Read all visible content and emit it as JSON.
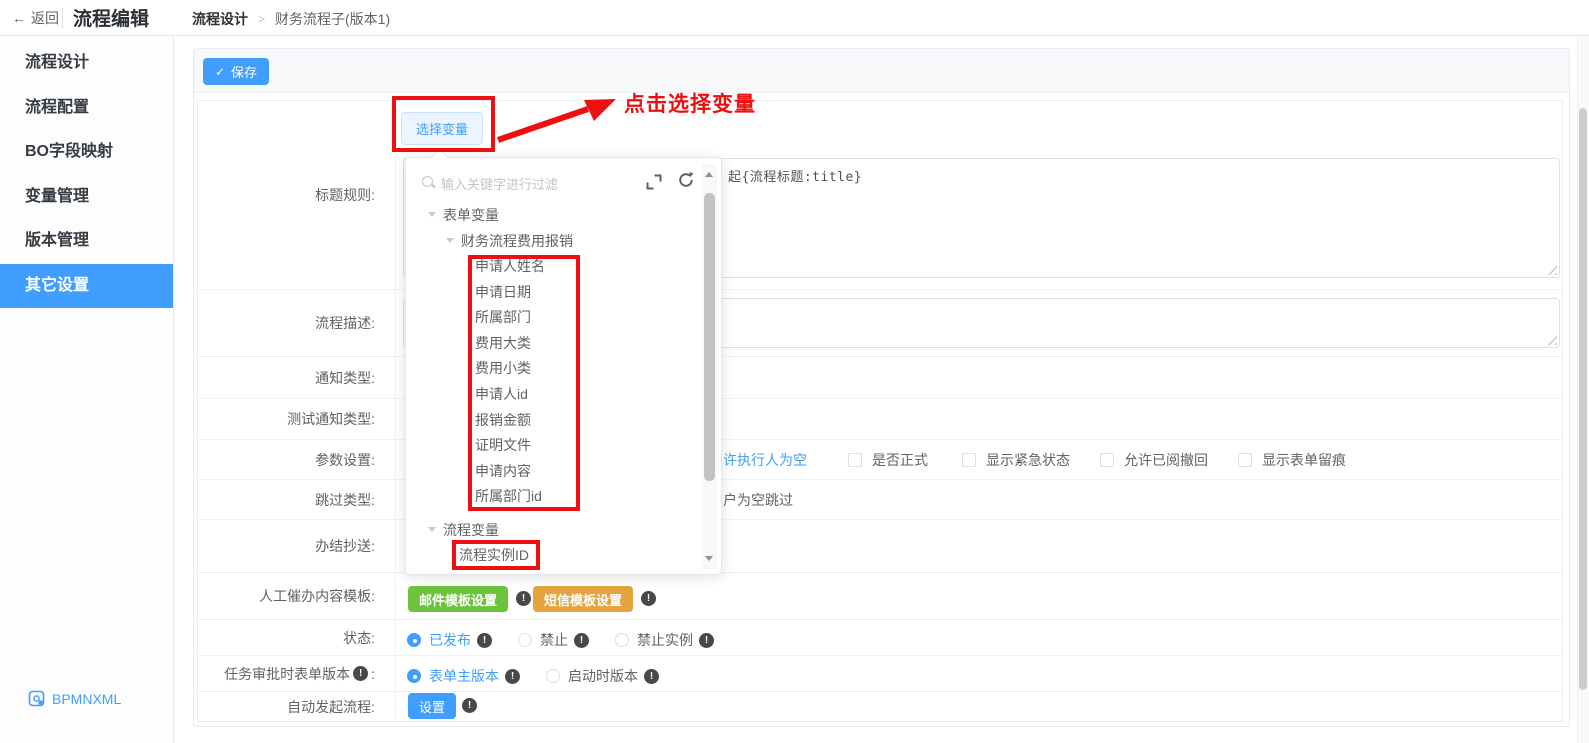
{
  "header": {
    "back": "返回",
    "title": "流程编辑",
    "breadcrumb_root": "流程设计",
    "breadcrumb_sep": ">",
    "breadcrumb_current": "财务流程子(版本1)"
  },
  "sidebar": {
    "items": [
      {
        "label": "流程设计"
      },
      {
        "label": "流程配置"
      },
      {
        "label": "BO字段映射"
      },
      {
        "label": "变量管理"
      },
      {
        "label": "版本管理"
      },
      {
        "label": "其它设置",
        "active": true
      }
    ],
    "footer": "BPMNXML"
  },
  "toolbar": {
    "save": "保存"
  },
  "form": {
    "labels": {
      "title_rule": "标题规则:",
      "description": "流程描述:",
      "notify_type": "通知类型:",
      "test_notify_type": "测试通知类型:",
      "param_setting": "参数设置:",
      "skip_type": "跳过类型:",
      "finish_cc": "办结抄送:",
      "manual_urge": "人工催办内容模板:",
      "status": "状态:",
      "task_form_version": "任务审批时表单版本",
      "task_form_version_colon": ":",
      "auto_start": "自动发起流程:"
    },
    "title_rule_visible_text": "起{流程标题:title}",
    "param_link_fragment": "许执行人为空",
    "param_checkboxes": [
      {
        "label": "是否正式"
      },
      {
        "label": "显示紧急状态"
      },
      {
        "label": "允许已阅撤回"
      },
      {
        "label": "显示表单留痕"
      }
    ],
    "skip_fragment": "户为空跳过",
    "template_buttons": [
      {
        "label": "邮件模板设置",
        "type": "email"
      },
      {
        "label": "短信模板设置",
        "type": "sms"
      }
    ],
    "status_options": [
      {
        "label": "已发布",
        "selected": true
      },
      {
        "label": "禁止"
      },
      {
        "label": "禁止实例"
      }
    ],
    "version_options": [
      {
        "label": "表单主版本",
        "selected": true
      },
      {
        "label": "启动时版本"
      }
    ],
    "auto_start_button": "设置"
  },
  "popup": {
    "trigger": "选择变量",
    "search_placeholder": "输入关键字进行过滤",
    "tree": {
      "root": "表单变量",
      "group": "财务流程费用报销",
      "fields": [
        "申请人姓名",
        "申请日期",
        "所属部门",
        "费用大类",
        "费用小类",
        "申请人id",
        "报销金额",
        "证明文件",
        "申请内容",
        "所属部门id"
      ],
      "root2": "流程变量",
      "fields2": [
        "流程实例ID"
      ]
    }
  },
  "annotation": {
    "label": "点击选择变量"
  },
  "colors": {
    "primary": "#409eff",
    "success": "#6cc43c",
    "warning": "#e3a33d",
    "annotation_red": "#ee1010"
  }
}
